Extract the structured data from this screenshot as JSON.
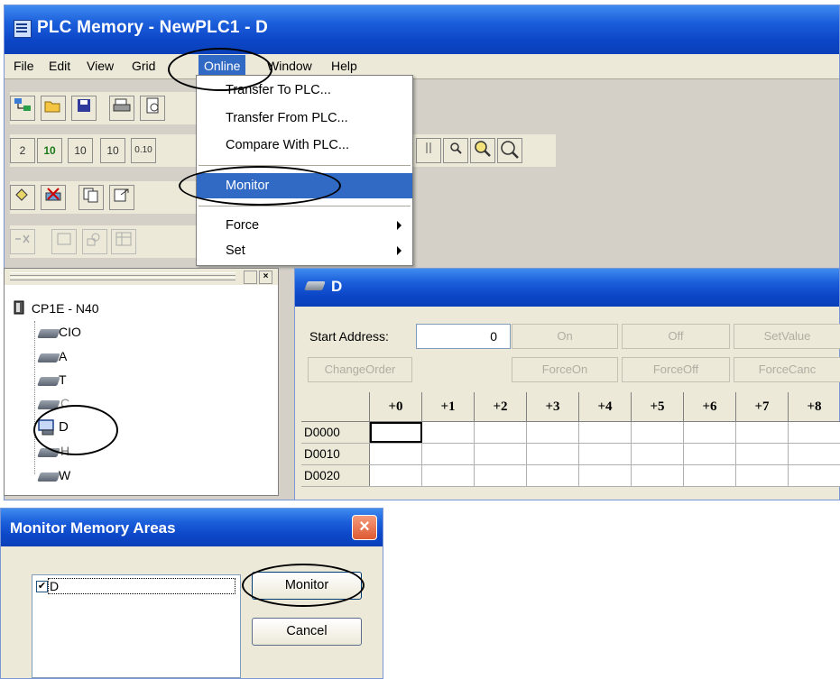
{
  "main_window": {
    "title": "PLC Memory - NewPLC1 - D",
    "menu": [
      "File",
      "Edit",
      "View",
      "Grid",
      "Online",
      "Window",
      "Help"
    ],
    "active_menu": "Online"
  },
  "online_menu": {
    "items": [
      {
        "label": "Transfer To PLC..."
      },
      {
        "label": "Transfer From PLC..."
      },
      {
        "label": "Compare With PLC..."
      },
      {
        "label": "Monitor",
        "highlighted": true
      },
      {
        "label": "Force",
        "submenu": true
      },
      {
        "label": "Set",
        "submenu": true
      }
    ]
  },
  "tree": {
    "root": "CP1E - N40",
    "items": [
      "CIO",
      "A",
      "T",
      "C",
      "D",
      "H",
      "W"
    ],
    "selected": "D"
  },
  "d_window": {
    "title": "D",
    "start_address_label": "Start Address:",
    "start_address_value": "0",
    "buttons_row1": [
      "On",
      "Off",
      "SetValue"
    ],
    "buttons_row2": [
      "ChangeOrder",
      "ForceOn",
      "ForceOff",
      "ForceCanc"
    ],
    "columns": [
      "+0",
      "+1",
      "+2",
      "+3",
      "+4",
      "+5",
      "+6",
      "+7",
      "+8"
    ],
    "rows": [
      "D0000",
      "D0010",
      "D0020"
    ]
  },
  "monitor_dialog": {
    "title": "Monitor Memory Areas",
    "list_item": "D",
    "list_item_checked": true,
    "monitor_label": "Monitor",
    "cancel_label": "Cancel"
  },
  "toolbar_glyphs": {
    "zoom_labels": [
      "2",
      "10",
      "10",
      "10",
      "0.10"
    ]
  },
  "colors": {
    "titlebar": "#0c47c8",
    "menu_highlight": "#316ac5",
    "close_button": "#de5a33"
  }
}
